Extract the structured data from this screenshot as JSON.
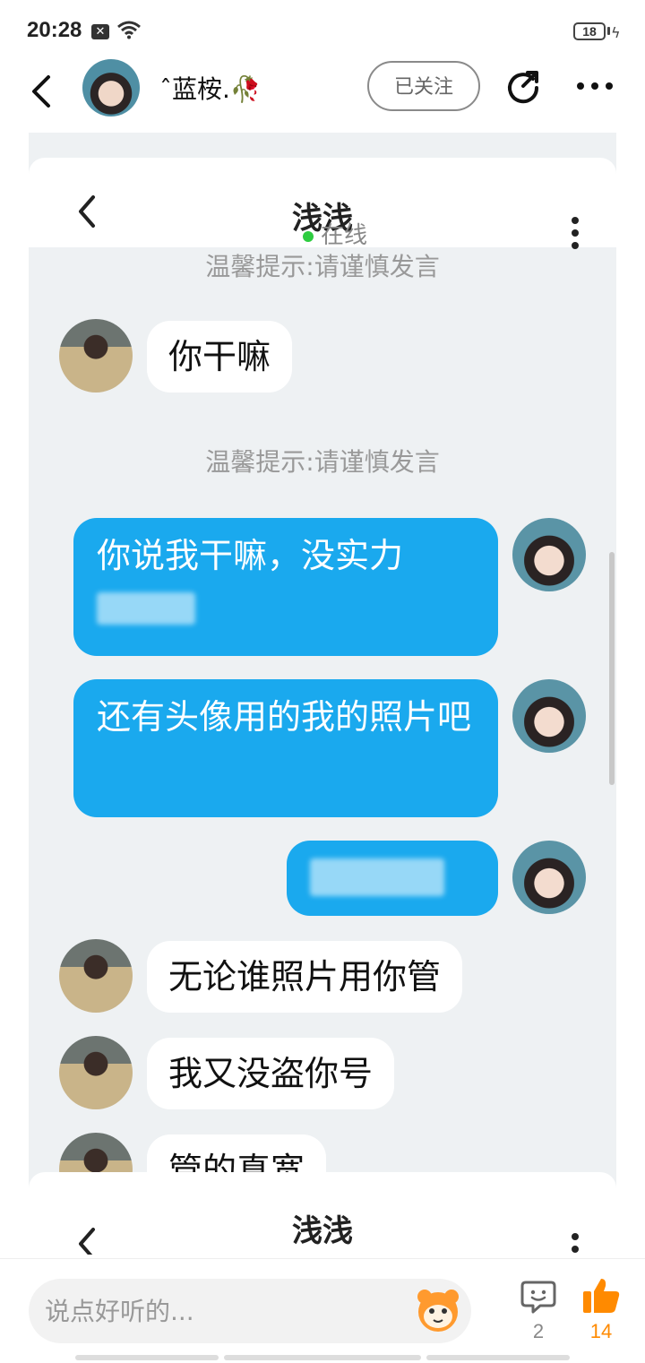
{
  "status_bar": {
    "time": "20:28",
    "battery": "18"
  },
  "header": {
    "username": "ˆ蓝桉.🥀",
    "follow_label": "已关注"
  },
  "chat_screenshot": {
    "contact_name": "浅浅",
    "status": "在线",
    "tip": "温馨提示:请谨慎发言",
    "messages": [
      {
        "side": "in",
        "text": "你干嘛"
      },
      {
        "side": "out",
        "text": "你说我干嘛，没实力"
      },
      {
        "side": "out",
        "text": "还有头像用的我的照片吧"
      },
      {
        "side": "in",
        "text": "无论谁照片用你管"
      },
      {
        "side": "in",
        "text": "我又没盗你号"
      },
      {
        "side": "in",
        "text": "管的真宽"
      }
    ]
  },
  "bottom_bar": {
    "comment_placeholder": "说点好听的...",
    "comment_count": "2",
    "like_count": "14"
  },
  "colors": {
    "bubble_out": "#1aa9ee",
    "like": "#ff8a00",
    "online": "#2ecc40"
  },
  "icons": [
    "back-icon",
    "share-icon",
    "more-icon",
    "emoji-icon",
    "comment-icon",
    "thumbs-up-icon",
    "wifi-icon",
    "battery-icon"
  ]
}
